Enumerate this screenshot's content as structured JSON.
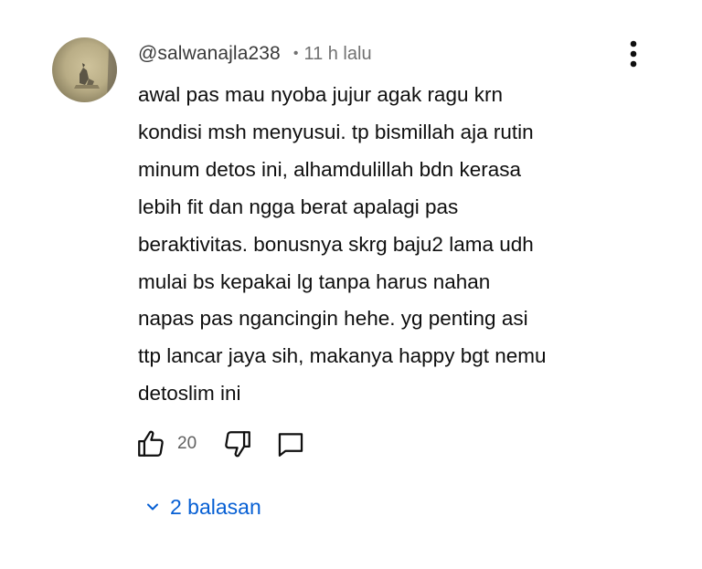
{
  "comment": {
    "username": "@salwanajla238",
    "separator": "•",
    "timestamp": "11 h lalu",
    "text_lines": [
      "awal pas mau nyoba jujur agak ragu krn",
      "kondisi msh menyusui. tp bismillah aja rutin",
      "minum detos ini, alhamdulillah bdn kerasa",
      "lebih fit dan ngga berat apalagi pas",
      "beraktivitas. bonusnya skrg baju2 lama udh",
      "mulai bs kepakai lg tanpa harus nahan",
      "napas pas ngancingin hehe. yg penting asi",
      "ttp lancar jaya sih, makanya happy bgt nemu",
      "detoslim ini"
    ],
    "like_count": "20",
    "replies_label": "2 balasan",
    "icons": {
      "more": "more-vertical-icon",
      "like": "thumbs-up-icon",
      "dislike": "thumbs-down-icon",
      "reply": "comment-icon",
      "expand": "chevron-down-icon"
    },
    "colors": {
      "text": "#0f0f0f",
      "username": "#3a3a3a",
      "meta": "#717171",
      "link": "#065fd4"
    }
  }
}
